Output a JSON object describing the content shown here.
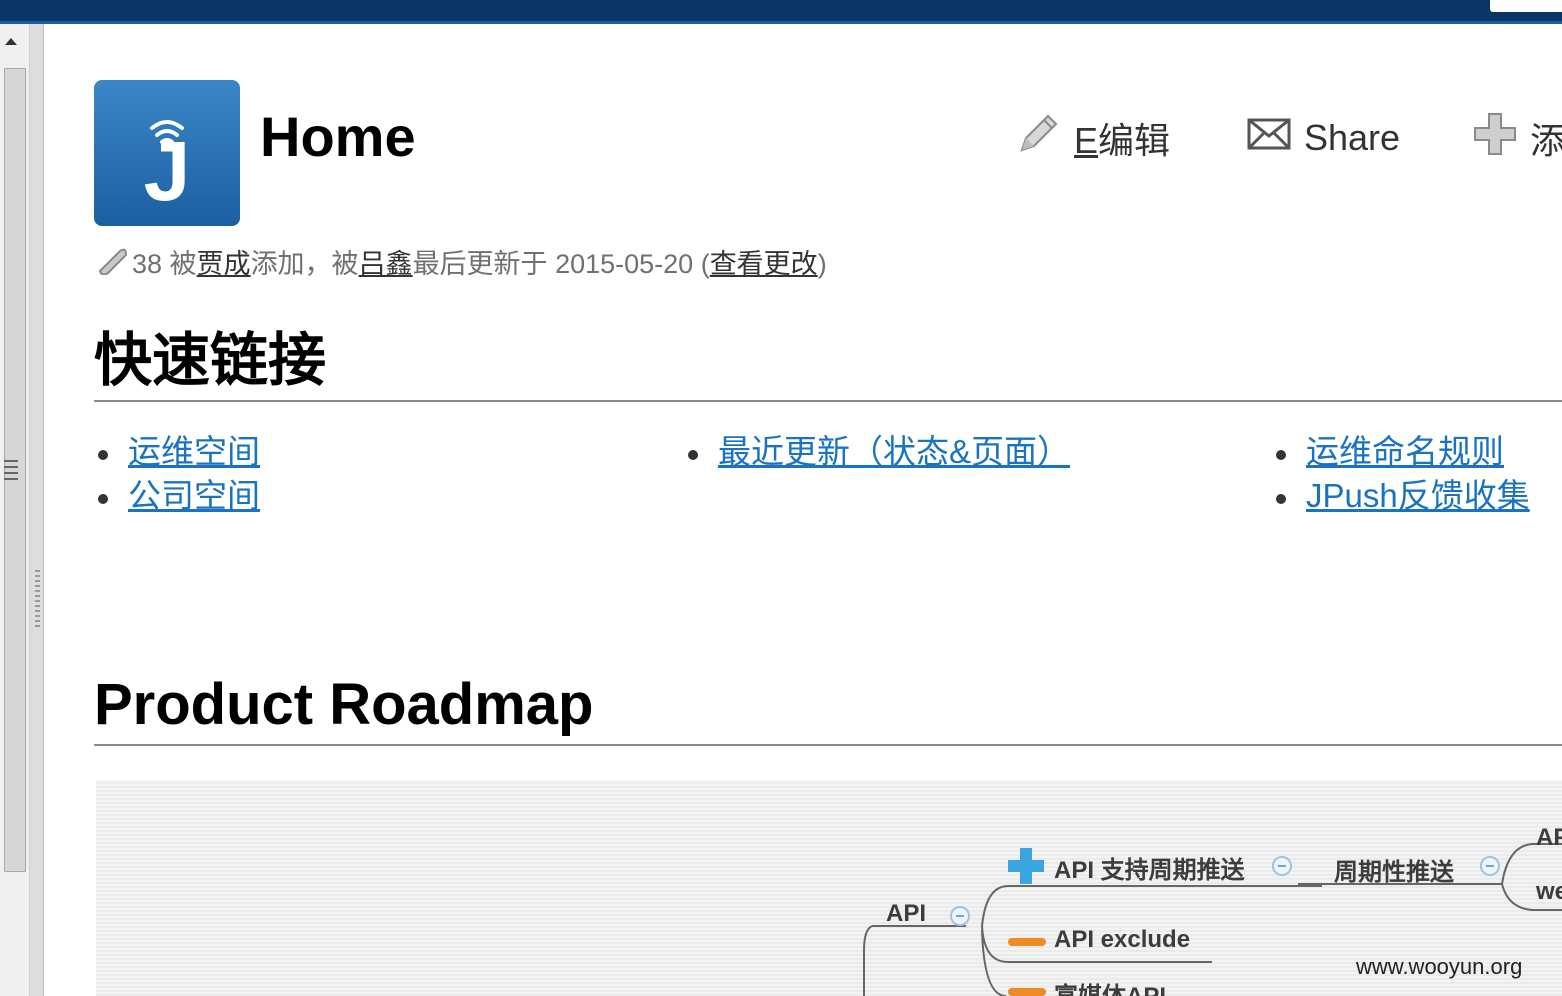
{
  "colors": {
    "topbar": "#0b3566",
    "link": "#1a73c2",
    "logo_top": "#3b87c8",
    "logo_bottom": "#1c5fa3"
  },
  "page": {
    "title": "Home",
    "logo_letter": "J"
  },
  "actions": {
    "edit_accel": "E",
    "edit_label": "编辑",
    "share_label": "Share",
    "add_label": "添"
  },
  "meta": {
    "attachments": "38",
    "prefix": " 被",
    "creator": "贾成",
    "middle": "添加，被",
    "updater": "吕鑫",
    "updated_text": "最后更新于 2015-05-20 ",
    "paren_open": "(",
    "view_changes": "查看更改",
    "paren_close": ")"
  },
  "sections": {
    "quick_links_title": "快速链接",
    "roadmap_title": "Product Roadmap"
  },
  "quick_links": {
    "col1": [
      "运维空间",
      "公司空间"
    ],
    "col2": [
      "最近更新（状态&页面）"
    ],
    "col3": [
      "运维命名规则",
      "JPush反馈收集"
    ]
  },
  "roadmap": {
    "root": "API",
    "node_cycle": "API 支持周期推送",
    "node_cycle_child": "周期性推送",
    "node_exclude": "API exclude",
    "node_rich": "富媒体API",
    "edge_top": "AP",
    "edge_bottom": "we"
  },
  "watermark": "www.wooyun.org"
}
